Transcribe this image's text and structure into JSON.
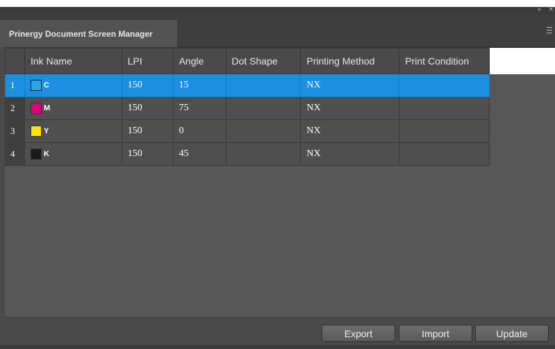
{
  "window": {
    "tab_title": "Prinergy Document Screen Manager",
    "collapse_glyph": "«",
    "close_glyph": "✕"
  },
  "table": {
    "columns": [
      "Ink Name",
      "LPI",
      "Angle",
      "Dot Shape",
      "Printing Method",
      "Print Condition"
    ],
    "rows": [
      {
        "index": "1",
        "ink": "C",
        "swatch_color": "#29a8e0",
        "lpi": "150",
        "angle": "15",
        "dot_shape": "",
        "printing_method": "NX",
        "print_condition": "",
        "selected": true
      },
      {
        "index": "2",
        "ink": "M",
        "swatch_color": "#e2007a",
        "lpi": "150",
        "angle": "75",
        "dot_shape": "",
        "printing_method": "NX",
        "print_condition": "",
        "selected": false
      },
      {
        "index": "3",
        "ink": "Y",
        "swatch_color": "#ffe600",
        "lpi": "150",
        "angle": "0",
        "dot_shape": "",
        "printing_method": "NX",
        "print_condition": "",
        "selected": false
      },
      {
        "index": "4",
        "ink": "K",
        "swatch_color": "#1a1a1a",
        "lpi": "150",
        "angle": "45",
        "dot_shape": "",
        "printing_method": "NX",
        "print_condition": "",
        "selected": false
      }
    ]
  },
  "footer": {
    "export_label": "Export",
    "import_label": "Import",
    "update_label": "Update"
  },
  "colors": {
    "selection": "#1d8fe0",
    "panel_bg": "#535353"
  }
}
